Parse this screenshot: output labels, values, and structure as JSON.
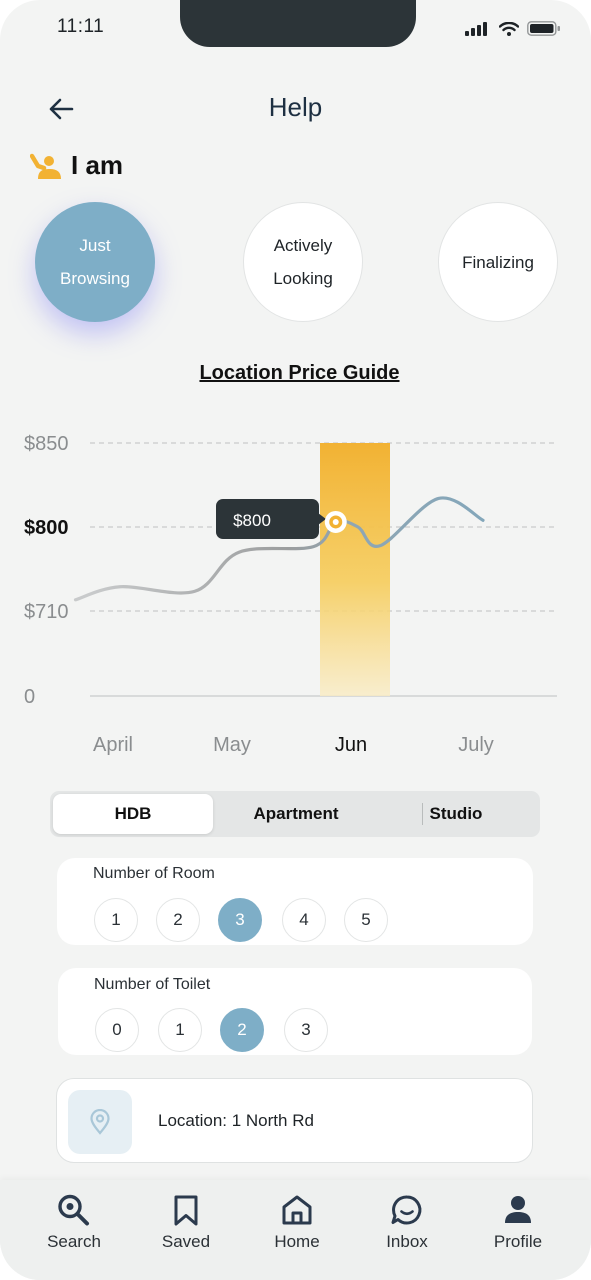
{
  "status_bar": {
    "time": "11:11",
    "icons": [
      "signal-icon",
      "wifi-icon",
      "battery-icon"
    ]
  },
  "header": {
    "title": "Help",
    "back_icon": "back-arrow-icon"
  },
  "i_am": {
    "label": "I am",
    "icon": "hand-raised-person-icon",
    "icon_color": "#f2b233"
  },
  "stages": [
    {
      "lines": [
        "Just",
        "Browsing"
      ],
      "selected": true
    },
    {
      "lines": [
        "Actively",
        "Looking"
      ],
      "selected": false
    },
    {
      "lines": [
        "Finalizing"
      ],
      "selected": false
    }
  ],
  "chart_data": {
    "type": "line",
    "title": "Location Price Guide",
    "y_ticks": [
      "$850",
      "$800",
      "$710",
      "0"
    ],
    "y_tick_values": [
      850,
      800,
      710,
      0
    ],
    "x_labels": [
      "April",
      "May",
      "Jun",
      "July"
    ],
    "highlighted_x": "Jun",
    "tooltip": "$800",
    "line_color": "#7fa7bd",
    "highlight_color": "#f2b233",
    "points": [
      {
        "x": "April",
        "y": 722
      },
      {
        "x": "April",
        "y": 736
      },
      {
        "x": "May",
        "y": 731
      },
      {
        "x": "May",
        "y": 773
      },
      {
        "x": "Jun",
        "y": 779
      },
      {
        "x": "Jun",
        "y": 803
      },
      {
        "x": "Jun",
        "y": 800
      },
      {
        "x": "Jun",
        "y": 780
      },
      {
        "x": "July",
        "y": 817
      },
      {
        "x": "July",
        "y": 804
      }
    ]
  },
  "property_types": {
    "options": [
      "HDB",
      "Apartment",
      "Studio"
    ],
    "selected": "HDB"
  },
  "rooms": {
    "title": "Number of Room",
    "options": [
      "1",
      "2",
      "3",
      "4",
      "5"
    ],
    "selected": "3"
  },
  "toilets": {
    "title": "Number of Toilet",
    "options": [
      "0",
      "1",
      "2",
      "3"
    ],
    "selected": "2"
  },
  "location": {
    "text": "Location: 1 North Rd",
    "icon": "location-pin-icon"
  },
  "nav": {
    "items": [
      {
        "label": "Search",
        "icon": "search-icon"
      },
      {
        "label": "Saved",
        "icon": "bookmark-icon"
      },
      {
        "label": "Home",
        "icon": "home-icon"
      },
      {
        "label": "Inbox",
        "icon": "chat-icon"
      },
      {
        "label": "Profile",
        "icon": "profile-icon"
      }
    ]
  },
  "colors": {
    "accent": "#7eaec7",
    "highlight": "#f2b233",
    "dark": "#2c3438"
  }
}
